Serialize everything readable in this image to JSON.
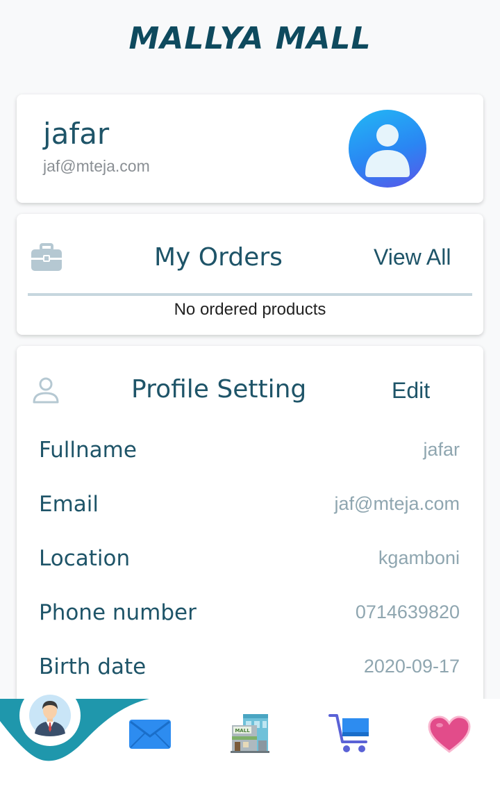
{
  "app": {
    "brand": "MALLYA MALL"
  },
  "user": {
    "name": "jafar",
    "email": "jaf@mteja.com"
  },
  "orders": {
    "title": "My Orders",
    "view_all": "View All",
    "empty_text": "No ordered products"
  },
  "profile": {
    "title": "Profile Setting",
    "edit": "Edit",
    "fields": [
      {
        "label": "Fullname",
        "value": "jafar"
      },
      {
        "label": "Email",
        "value": "jaf@mteja.com"
      },
      {
        "label": "Location",
        "value": "kgamboni"
      },
      {
        "label": "Phone number",
        "value": "0714639820"
      },
      {
        "label": "Birth date",
        "value": "2020-09-17"
      }
    ]
  },
  "bottom_nav": {
    "items": [
      {
        "icon": "businessman-avatar-icon",
        "active": true
      },
      {
        "icon": "envelope-icon"
      },
      {
        "icon": "mall-building-icon"
      },
      {
        "icon": "shopping-cart-icon"
      },
      {
        "icon": "heart-icon"
      }
    ]
  },
  "colors": {
    "primary": "#1e5468",
    "accent_teal": "#1f97ac",
    "muted": "#8fa6b0"
  }
}
